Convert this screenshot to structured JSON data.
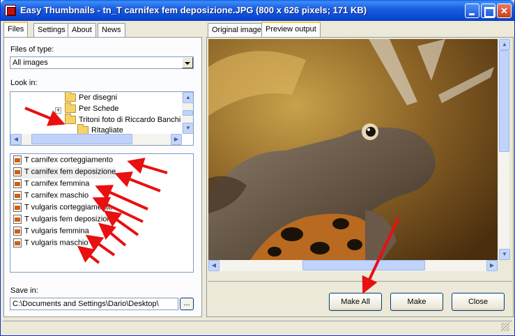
{
  "window": {
    "title": "Easy Thumbnails - tn_T carnifex fem deposizione.JPG  (800 x 626 pixels;  171 KB)"
  },
  "left_tabs": [
    "Files",
    "Settings",
    "About",
    "News"
  ],
  "right_tabs": [
    "Original image",
    "Preview output"
  ],
  "files_of_type": {
    "label": "Files of type:",
    "value": "All images"
  },
  "look_in": {
    "label": "Look in:",
    "folders": [
      "Per disegni",
      "Per Schede",
      "Tritoni foto di Riccardo Banchi",
      "Ritagliate"
    ]
  },
  "file_list": [
    "T carnifex corteggiamento",
    "T carnifex fem deposizione",
    "T carnifex femmina",
    "T carnifex maschio",
    "T vulgaris corteggiamento",
    "T vulgaris fem deposizione",
    "T vulgaris femmina",
    "T vulgaris maschio"
  ],
  "save_in": {
    "label": "Save in:",
    "value": "C:\\Documents and Settings\\Dario\\Desktop\\",
    "browse_label": "..."
  },
  "buttons": {
    "make_all": "Make All",
    "make": "Make",
    "close": "Close"
  },
  "colors": {
    "annotation_arrow": "#e81010",
    "titlebar": "#0a48d4",
    "panel": "#ece9d8"
  }
}
